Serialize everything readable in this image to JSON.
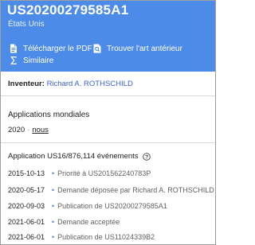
{
  "header": {
    "patent_number": "US20200279585A1",
    "country": "États Unis",
    "actions": {
      "download_pdf": "Télécharger le PDF",
      "prior_art": "Trouver l'art antérieur",
      "similar": "Similaire"
    }
  },
  "inventor": {
    "label": "Inventeur:",
    "name": "Richard A. ROTHSCHILD"
  },
  "world_applications": {
    "title": "Applications mondiales",
    "year": "2020",
    "separator": "·",
    "country_link": "nous"
  },
  "events": {
    "title": "Application US16/876,114 événements",
    "items": [
      {
        "date": "2015-10-13",
        "text": "Priorité à US201562240783P"
      },
      {
        "date": "2020-05-17",
        "text": "Demande déposée par Richard A. ROTHSCHILD"
      },
      {
        "date": "2020-09-03",
        "text": "Publication de US20200279585A1"
      },
      {
        "date": "2021-06-01",
        "text": "Demande acceptée"
      },
      {
        "date": "2021-06-01",
        "text": "Publication de US11024339B2"
      }
    ]
  },
  "colors": {
    "header_blue": "#4d8be8",
    "link_blue": "#3b63d3",
    "bullet_blue": "#4d8be8"
  },
  "icons": [
    "pdf-icon",
    "prior-art-search-icon",
    "sigma-icon",
    "help-icon",
    "bullet-icon"
  ]
}
